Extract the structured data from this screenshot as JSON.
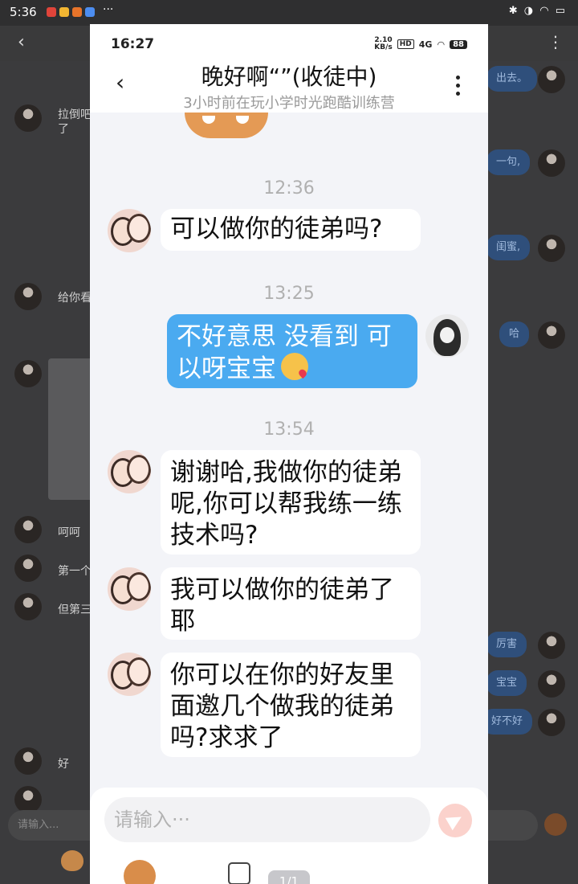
{
  "outer": {
    "status_time": "5:36",
    "status_dots": "···",
    "left_messages": [
      {
        "text": "拉倒吧\n了"
      },
      {
        "text": "给你看"
      },
      {
        "text": "呵呵"
      },
      {
        "text": "第一个"
      },
      {
        "text": "但第三"
      },
      {
        "text": "好"
      }
    ],
    "right_messages": [
      "出去。",
      "一句,",
      "闺蜜,",
      "哈",
      "厉害",
      "宝宝",
      "好不好"
    ],
    "input_placeholder": "请输入..."
  },
  "phone": {
    "status": {
      "time": "16:27",
      "speed": "2.10\nKB/s",
      "hd": "HD",
      "net": "4G",
      "battery": "88"
    },
    "header": {
      "title": "晚好啊“”(收徒中)",
      "subtitle": "3小时前在玩小学时光跑酷训练营"
    },
    "timestamps": [
      "12:36",
      "13:25",
      "13:54"
    ],
    "messages": [
      {
        "from": "other",
        "text": "可以做你的徒弟吗?"
      },
      {
        "from": "me",
        "text": "不好意思 没看到 可以呀宝宝",
        "emoji": "kissing-face-emoji"
      },
      {
        "from": "other",
        "text": "谢谢哈,我做你的徒弟呢,你可以帮我练一练技术吗?"
      },
      {
        "from": "other",
        "text": "我可以做你的徒弟了耶"
      },
      {
        "from": "other",
        "text": "你可以在你的好友里面邀几个做我的徒弟吗?求求了"
      }
    ],
    "input_placeholder": "请输入···",
    "page_indicator": "1/1"
  },
  "colors": {
    "my_bubble": "#4aaaf0",
    "other_bubble": "#ffffff",
    "chat_bg": "#f3f4f8"
  }
}
